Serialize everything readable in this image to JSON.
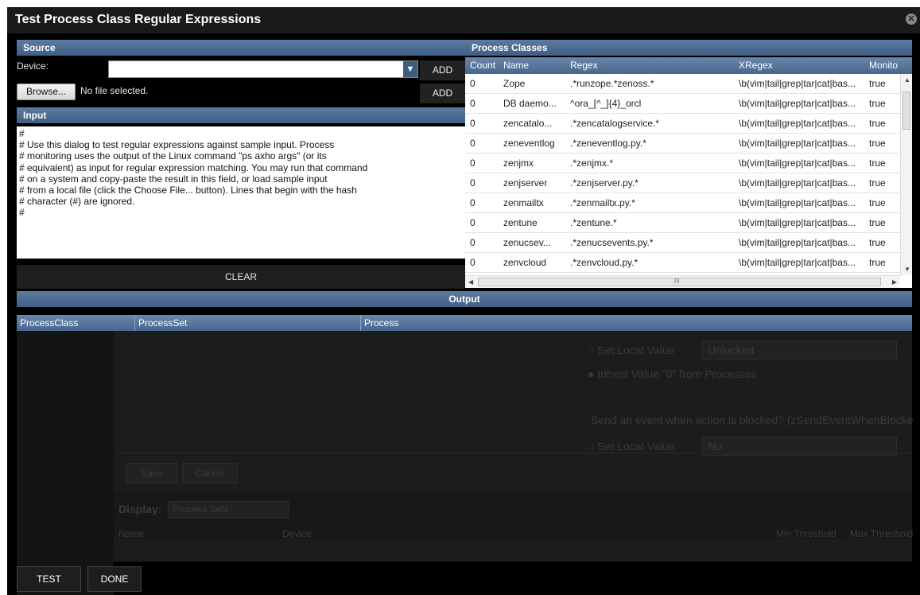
{
  "dialog": {
    "title": "Test Process Class Regular Expressions",
    "close_icon": "close-icon"
  },
  "source": {
    "heading": "Source",
    "device_label": "Device:",
    "device_value": "",
    "add_label": "ADD",
    "browse_label": "Browse...",
    "file_status": "No file selected.",
    "add_file_label": "ADD"
  },
  "input": {
    "heading": "Input",
    "text": "#\n# Use this dialog to test regular expressions against sample input. Process\n# monitoring uses the output of the Linux command \"ps axho args\" (or its\n# equivalent) as input for regular expression matching. You may run that command\n# on a system and copy-paste the result in this field, or load sample input\n# from a local file (click the Choose File... button). Lines that begin with the hash\n# character (#) are ignored.\n#",
    "clear_label": "CLEAR"
  },
  "process_classes": {
    "heading": "Process Classes",
    "columns": [
      "Count",
      "Name",
      "Regex",
      "XRegex",
      "Monito"
    ],
    "rows": [
      [
        "0",
        "Zope",
        ".*runzope.*zenoss.*",
        "\\b(vim|tail|grep|tar|cat|bas...",
        "true"
      ],
      [
        "0",
        "DB daemo...",
        "^ora_[^_]{4}_orcl",
        "\\b(vim|tail|grep|tar|cat|bas...",
        "true"
      ],
      [
        "0",
        "zencatalo...",
        ".*zencatalogservice.*",
        "\\b(vim|tail|grep|tar|cat|bas...",
        "true"
      ],
      [
        "0",
        "zeneventlog",
        ".*zeneventlog.py.*",
        "\\b(vim|tail|grep|tar|cat|bas...",
        "true"
      ],
      [
        "0",
        "zenjmx",
        ".*zenjmx.*",
        "\\b(vim|tail|grep|tar|cat|bas...",
        "true"
      ],
      [
        "0",
        "zenjserver",
        ".*zenjserver.py.*",
        "\\b(vim|tail|grep|tar|cat|bas...",
        "true"
      ],
      [
        "0",
        "zenmailtx",
        ".*zenmailtx.py.*",
        "\\b(vim|tail|grep|tar|cat|bas...",
        "true"
      ],
      [
        "0",
        "zentune",
        ".*zentune.*",
        "\\b(vim|tail|grep|tar|cat|bas...",
        "true"
      ],
      [
        "0",
        "zenucsev...",
        ".*zenucsevents.py.*",
        "\\b(vim|tail|grep|tar|cat|bas...",
        "true"
      ],
      [
        "0",
        "zenvcloud",
        ".*zenvcloud.py.*",
        "\\b(vim|tail|grep|tar|cat|bas...",
        "true"
      ]
    ],
    "hscroll_grip": "III"
  },
  "output": {
    "heading": "Output",
    "columns": [
      "ProcessClass",
      "ProcessSet",
      "Process"
    ]
  },
  "background": {
    "set_local_value": "Set Local Value",
    "unlocked": "Unlocked",
    "inherit": "Inherit Value \"0\" from Processes",
    "send_event": "Send an event when action is blocked? (zSendEventWhenBlocke",
    "set_local_value_2": "Set Local Value",
    "no": "No",
    "save": "Save",
    "cancel": "Cancel",
    "display_label": "Display:",
    "display_value": "Process Sets",
    "col_name": "Name",
    "col_device": "Device",
    "col_min": "Min Threshold",
    "col_max": "Max Threshold"
  },
  "footer": {
    "test_label": "TEST",
    "done_label": "DONE"
  }
}
